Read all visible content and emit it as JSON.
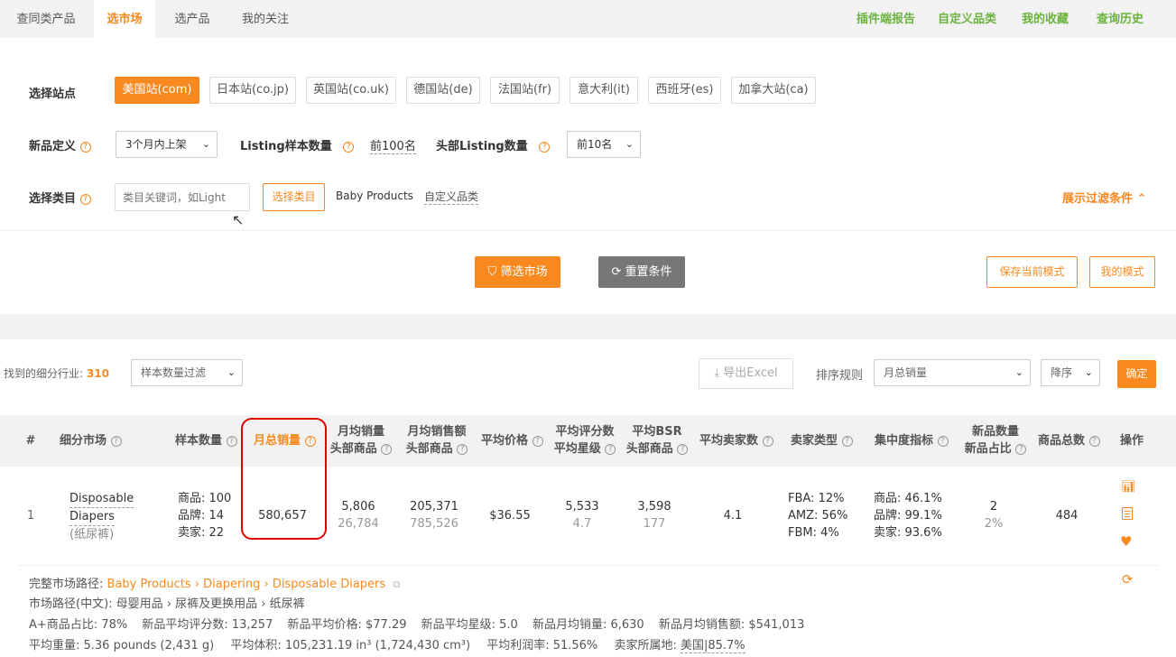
{
  "top_tabs": [
    {
      "label": "查同类产品"
    },
    {
      "label": "选市场"
    },
    {
      "label": "选产品"
    },
    {
      "label": "我的关注"
    }
  ],
  "top_links": [
    {
      "label": "插件端报告"
    },
    {
      "label": "自定义品类"
    },
    {
      "label": "我的收藏"
    },
    {
      "label": "查询历史"
    }
  ],
  "filters": {
    "site_label": "选择站点",
    "sites": [
      "美国站(com)",
      "日本站(co.jp)",
      "英国站(co.uk)",
      "德国站(de)",
      "法国站(fr)",
      "意大利(it)",
      "西班牙(es)",
      "加拿大站(ca)"
    ],
    "new_def_label": "新品定义",
    "new_def_value": "3个月内上架",
    "sample_label": "Listing样本数量",
    "sample_value": "前100名",
    "head_label": "头部Listing数量",
    "head_value": "前10名",
    "category_label": "选择类目",
    "category_placeholder": "类目关键词，如Light",
    "category_button": "选择类目",
    "category_selected": "Baby Products",
    "custom_category": "自定义品类",
    "expand_label": "展示过滤条件"
  },
  "actions": {
    "filter_button": "筛选市场",
    "reset_button": "重置条件",
    "save_mode": "保存当前模式",
    "my_mode": "我的模式"
  },
  "results": {
    "found_label": "找到的细分行业:",
    "found_count": "310",
    "sample_filter": "样本数量过滤",
    "export": "导出Excel",
    "sort_label": "排序规则",
    "sort_value": "月总销量",
    "order_value": "降序",
    "confirm": "确定"
  },
  "table": {
    "headers": {
      "idx": "#",
      "market": "细分市场",
      "sample": "样本数量",
      "total_sales": "月总销量",
      "avg_sales_1": "月均销量",
      "avg_sales_2": "头部商品",
      "avg_rev_1": "月均销售额",
      "avg_rev_2": "头部商品",
      "avg_price": "平均价格",
      "avg_rating_1": "平均评分数",
      "avg_rating_2": "平均星级",
      "avg_bsr_1": "平均BSR",
      "avg_bsr_2": "头部商品",
      "sellers": "平均卖家数",
      "seller_type": "卖家类型",
      "concentration": "集中度指标",
      "new_1": "新品数量",
      "new_2": "新品占比",
      "total_products": "商品总数",
      "ops": "操作"
    },
    "row": {
      "idx": "1",
      "market_name_1": "Disposable",
      "market_name_2": "Diapers",
      "market_cn": "(纸尿裤)",
      "sample_products": "商品: 100",
      "sample_brands": "品牌: 14",
      "sample_sellers": "卖家: 22",
      "total_sales": "580,657",
      "avg_sales": "5,806",
      "avg_sales_head": "26,784",
      "avg_rev": "205,371",
      "avg_rev_head": "785,526",
      "avg_price": "$36.55",
      "avg_reviews": "5,533",
      "avg_stars": "4.7",
      "avg_bsr": "3,598",
      "avg_bsr_head": "177",
      "sellers": "4.1",
      "fba": "FBA: 12%",
      "amz": "AMZ: 56%",
      "fbm": "FBM: 4%",
      "conc_products": "商品: 46.1%",
      "conc_brands": "品牌: 99.1%",
      "conc_sellers": "卖家: 93.6%",
      "new_count": "2",
      "new_ratio": "2%",
      "total_products": "484"
    }
  },
  "details": {
    "path_label": "完整市场路径:",
    "path_1": "Baby Products",
    "path_2": "Diapering",
    "path_3": "Disposable Diapers",
    "path_cn": "市场路径(中文): 母婴用品 › 尿裤及更换用品 › 纸尿裤",
    "aplus": "A+商品占比: 78%",
    "new_reviews": "新品平均评分数: 13,257",
    "new_price": "新品平均价格: $77.29",
    "new_stars": "新品平均星级: 5.0",
    "new_sales": "新品月均销量: 6,630",
    "new_rev": "新品月均销售额: $541,013",
    "weight": "平均重量: 5.36 pounds (2,431 g)",
    "volume": "平均体积: 105,231.19 in³ (1,724,430 cm³)",
    "margin": "平均利润率: 51.56%",
    "seller_loc_label": "卖家所属地:",
    "seller_loc_value": "美国|85.7%"
  },
  "colors": {
    "accent": "#f7891f",
    "green": "#6cb33f",
    "highlight": "#e00000"
  }
}
